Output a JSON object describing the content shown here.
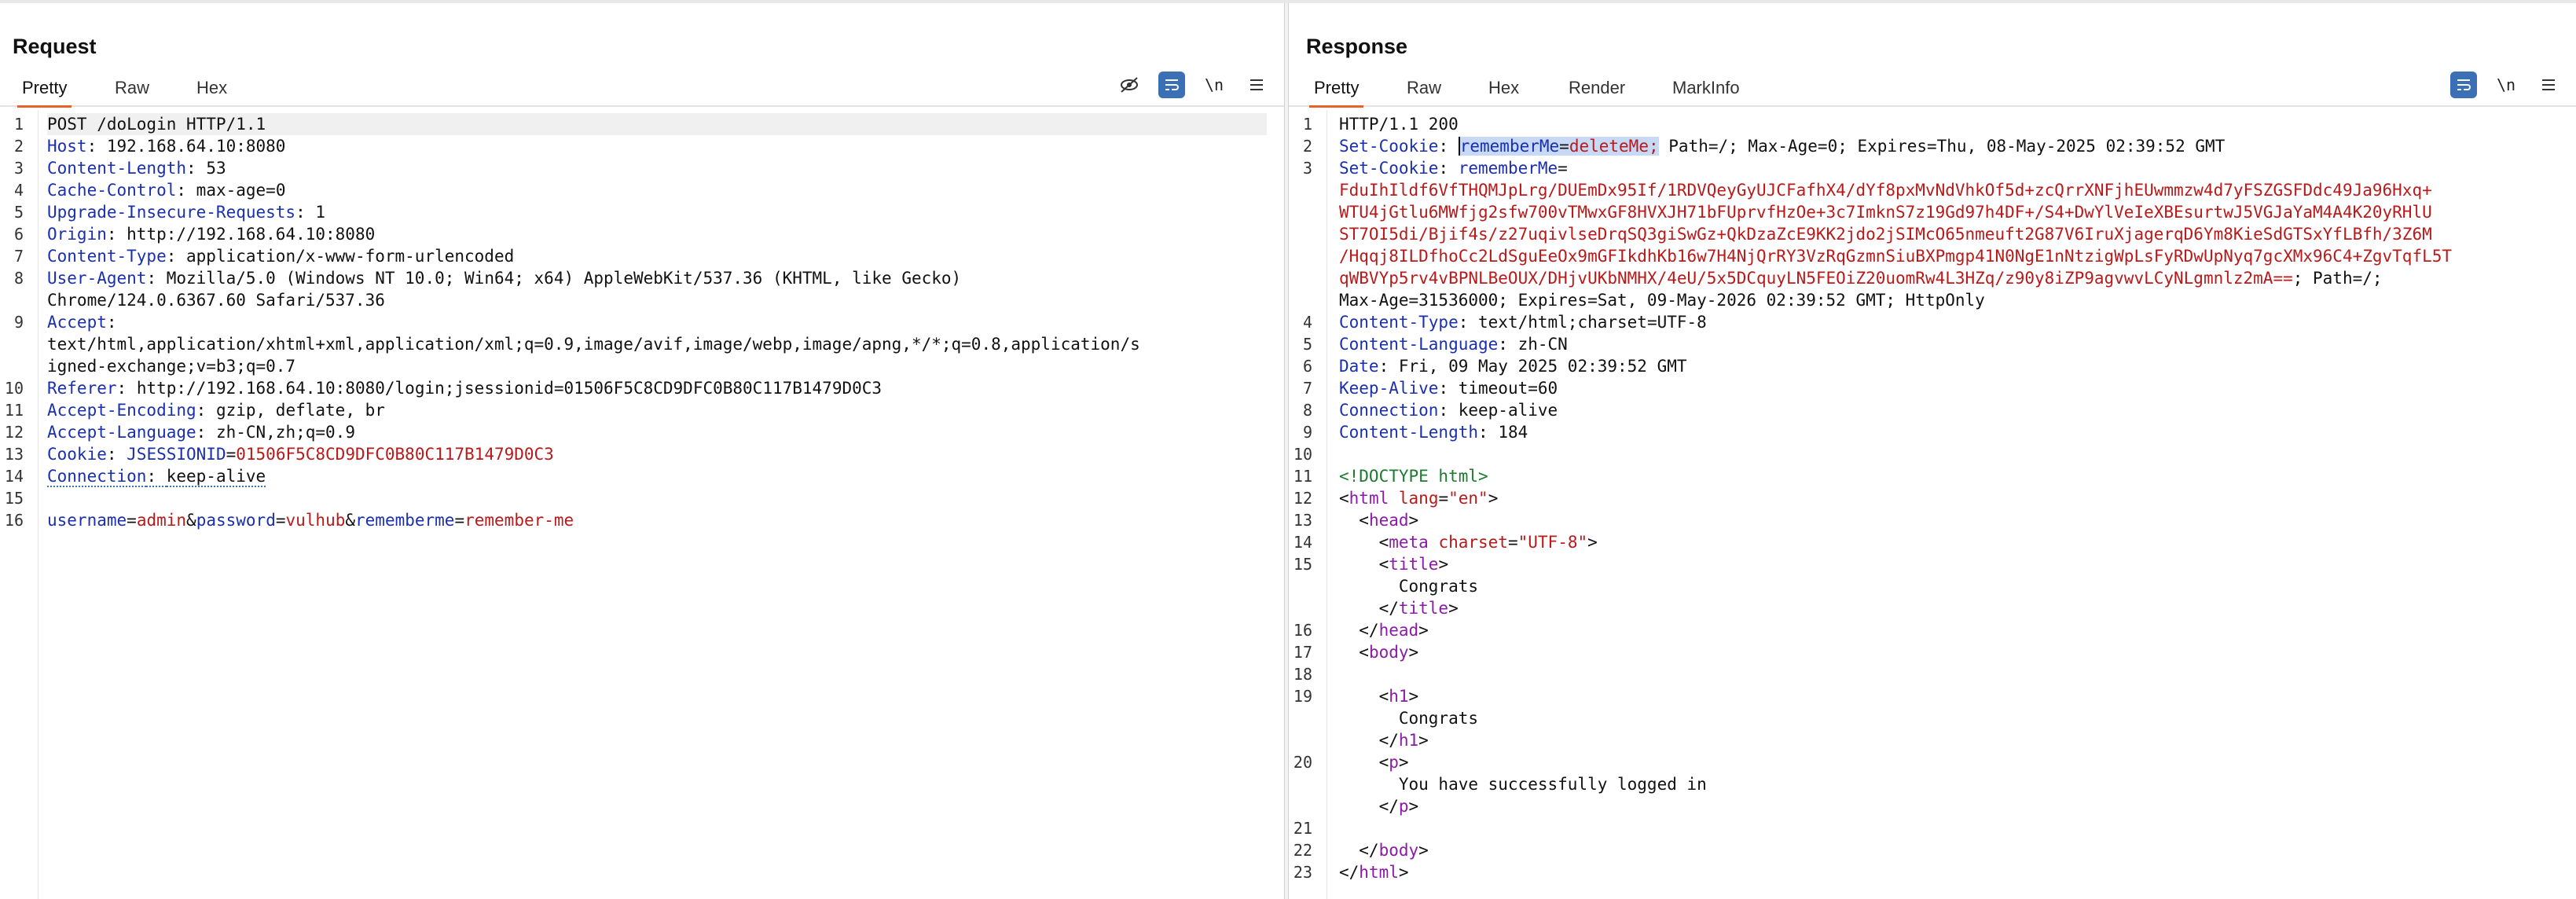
{
  "request": {
    "title": "Request",
    "tabs": [
      "Pretty",
      "Raw",
      "Hex"
    ],
    "active_tab": "Pretty",
    "tool_newline": "\\n",
    "lines": [
      {
        "n": "1",
        "text": "POST /doLogin HTTP/1.1"
      },
      {
        "n": "2",
        "key": "Host",
        "value": "192.168.64.10:8080"
      },
      {
        "n": "3",
        "key": "Content-Length",
        "value": "53"
      },
      {
        "n": "4",
        "key": "Cache-Control",
        "value": "max-age=0"
      },
      {
        "n": "5",
        "key": "Upgrade-Insecure-Requests",
        "value": "1"
      },
      {
        "n": "6",
        "key": "Origin",
        "value": "http://192.168.64.10:8080"
      },
      {
        "n": "7",
        "key": "Content-Type",
        "value": "application/x-www-form-urlencoded"
      },
      {
        "n": "8",
        "key": "User-Agent",
        "value": "Mozilla/5.0 (Windows NT 10.0; Win64; x64) AppleWebKit/537.36 (KHTML, like Gecko)",
        "cont": "Chrome/124.0.6367.60 Safari/537.36"
      },
      {
        "n": "9",
        "key": "Accept",
        "cont1": "text/html,application/xhtml+xml,application/xml;q=0.9,image/avif,image/webp,image/apng,*/*;q=0.8,application/s",
        "cont2": "igned-exchange;v=b3;q=0.7"
      },
      {
        "n": "10",
        "key": "Referer",
        "value": "http://192.168.64.10:8080/login;jsessionid=01506F5C8CD9DFC0B80C117B1479D0C3"
      },
      {
        "n": "11",
        "key": "Accept-Encoding",
        "value": "gzip, deflate, br"
      },
      {
        "n": "12",
        "key": "Accept-Language",
        "value": "zh-CN,zh;q=0.9"
      },
      {
        "n": "13",
        "key": "Cookie",
        "cookie_name": "JSESSIONID",
        "cookie_value": "01506F5C8CD9DFC0B80C117B1479D0C3"
      },
      {
        "n": "14",
        "key": "Connection",
        "value": "keep-alive"
      },
      {
        "n": "15",
        "text": ""
      },
      {
        "n": "16",
        "params": [
          {
            "k": "username",
            "v": "admin"
          },
          {
            "k": "password",
            "v": "vulhub"
          },
          {
            "k": "rememberme",
            "v": "remember-me"
          }
        ]
      }
    ]
  },
  "response": {
    "title": "Response",
    "tabs": [
      "Pretty",
      "Raw",
      "Hex",
      "Render",
      "MarkInfo"
    ],
    "active_tab": "Pretty",
    "tool_newline": "\\n",
    "status_line": "HTTP/1.1 200",
    "set_cookie_1": {
      "key": "Set-Cookie",
      "name": "rememberMe",
      "value": "deleteMe;",
      "rest": "Path=/; Max-Age=0; Expires=Thu, 08-May-2025 02:39:52 GMT"
    },
    "set_cookie_2": {
      "key": "Set-Cookie",
      "name": "rememberMe",
      "value_lines": [
        "FduIhIldf6VfTHQMJpLrg/DUEmDx95If/1RDVQeyGyUJCFafhX4/dYf8pxMvNdVhkOf5d+zcQrrXNFjhEUwmmzw4d7yFSZGSFDdc49Ja96Hxq+",
        "WTU4jGtlu6MWfjg2sfw700vTMwxGF8HVXJH71bFUprvfHzOe+3c7ImknS7z19Gd97h4DF+/S4+DwYlVeIeXBEsurtwJ5VGJaYaM4A4K20yRHlU",
        "ST7OI5di/Bjif4s/z27uqivlseDrqSQ3giSwGz+QkDzaZcE9KK2jdo2jSIMcO65nmeuft2G87V6IruXjagerqD6Ym8KieSdGTSxYfLBfh/3Z6M",
        "/Hqqj8ILDfhoCc2LdSguEeOx9mGFIkdhKb16w7H4NjQrRY3VzRqGzmnSiuBXPmgp41N0NgE1nNtzigWpLsFyRDwUpNyq7gcXMx96C4+ZgvTqfL5T",
        "qWBVYp5rv4vBPNLBeOUX/DHjvUKbNMHX/4eU/5x5DCquyLN5FEOiZ20uomRw4L3HZq/z90y8iZP9agvwvLCyNLgmnlz2mA=="
      ],
      "after": "; Path=/;",
      "cont": "Max-Age=31536000; Expires=Sat, 09-May-2026 02:39:52 GMT; HttpOnly"
    },
    "headers": [
      {
        "n": "4",
        "key": "Content-Type",
        "value": "text/html;charset=UTF-8"
      },
      {
        "n": "5",
        "key": "Content-Language",
        "value": "zh-CN"
      },
      {
        "n": "6",
        "key": "Date",
        "value": "Fri, 09 May 2025 02:39:52 GMT"
      },
      {
        "n": "7",
        "key": "Keep-Alive",
        "value": "timeout=60"
      },
      {
        "n": "8",
        "key": "Connection",
        "value": "keep-alive"
      },
      {
        "n": "9",
        "key": "Content-Length",
        "value": "184"
      }
    ],
    "html": {
      "doctype": "<!DOCTYPE html>",
      "html_tag": "html",
      "lang_attr": "lang",
      "lang_val": "\"en\"",
      "head": "head",
      "meta": "meta",
      "charset_attr": "charset",
      "charset_val": "\"UTF-8\"",
      "title_tag": "title",
      "title_text": "Congrats",
      "body": "body",
      "h1": "h1",
      "h1_text": "Congrats",
      "p": "p",
      "p_text": "You have successfully logged in"
    },
    "line_numbers": [
      "1",
      "2",
      "3",
      "4",
      "5",
      "6",
      "7",
      "8",
      "9",
      "10",
      "11",
      "12",
      "13",
      "14",
      "15",
      "16",
      "17",
      "18",
      "19",
      "20",
      "21",
      "22",
      "23"
    ]
  },
  "colors": {
    "accent": "#e8622c",
    "toggle_blue": "#3b6fb6",
    "header_key": "#1a2fb0",
    "value_red": "#b81a1a",
    "tag_purple": "#8b1aa8"
  }
}
